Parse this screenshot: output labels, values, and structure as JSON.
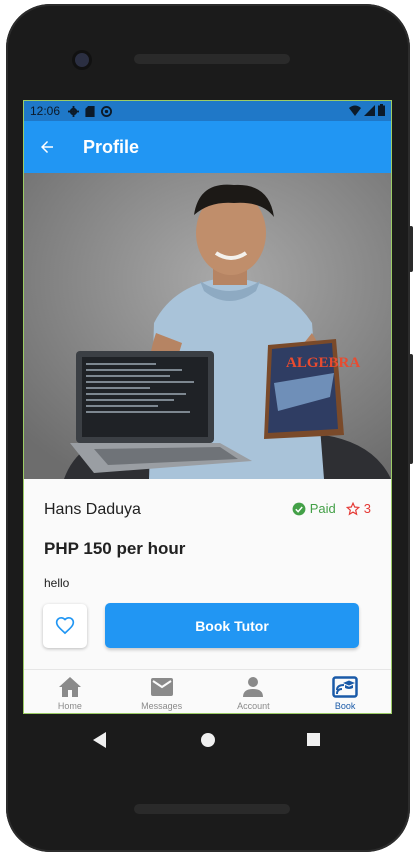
{
  "status_bar": {
    "time": "12:06",
    "left_icons": [
      "gear-icon",
      "sd-card-icon",
      "at-sign-icon"
    ],
    "right_icons": [
      "wifi-icon",
      "cell-signal-icon",
      "battery-icon"
    ]
  },
  "app_bar": {
    "title": "Profile",
    "back_icon": "arrow-back-icon"
  },
  "profile": {
    "name": "Hans Daduya",
    "paid_label": "Paid",
    "rating": "3",
    "price": "PHP 150 per hour",
    "bio": "hello",
    "photo_book_text": "ALGEBRA"
  },
  "actions": {
    "favorite_icon": "heart-outline-icon",
    "book_label": "Book Tutor"
  },
  "bottom_nav": {
    "items": [
      {
        "label": "Home",
        "icon": "home-icon"
      },
      {
        "label": "Messages",
        "icon": "mail-icon"
      },
      {
        "label": "Account",
        "icon": "person-icon"
      },
      {
        "label": "Book",
        "icon": "cast-for-education-icon",
        "active": true
      }
    ]
  },
  "colors": {
    "primary": "#2196f3",
    "status_bar": "#1f78c8",
    "paid_green": "#43a047",
    "rating_red": "#e53935",
    "active_nav": "#1a5aa8",
    "inactive_nav": "#8a8a8a"
  }
}
